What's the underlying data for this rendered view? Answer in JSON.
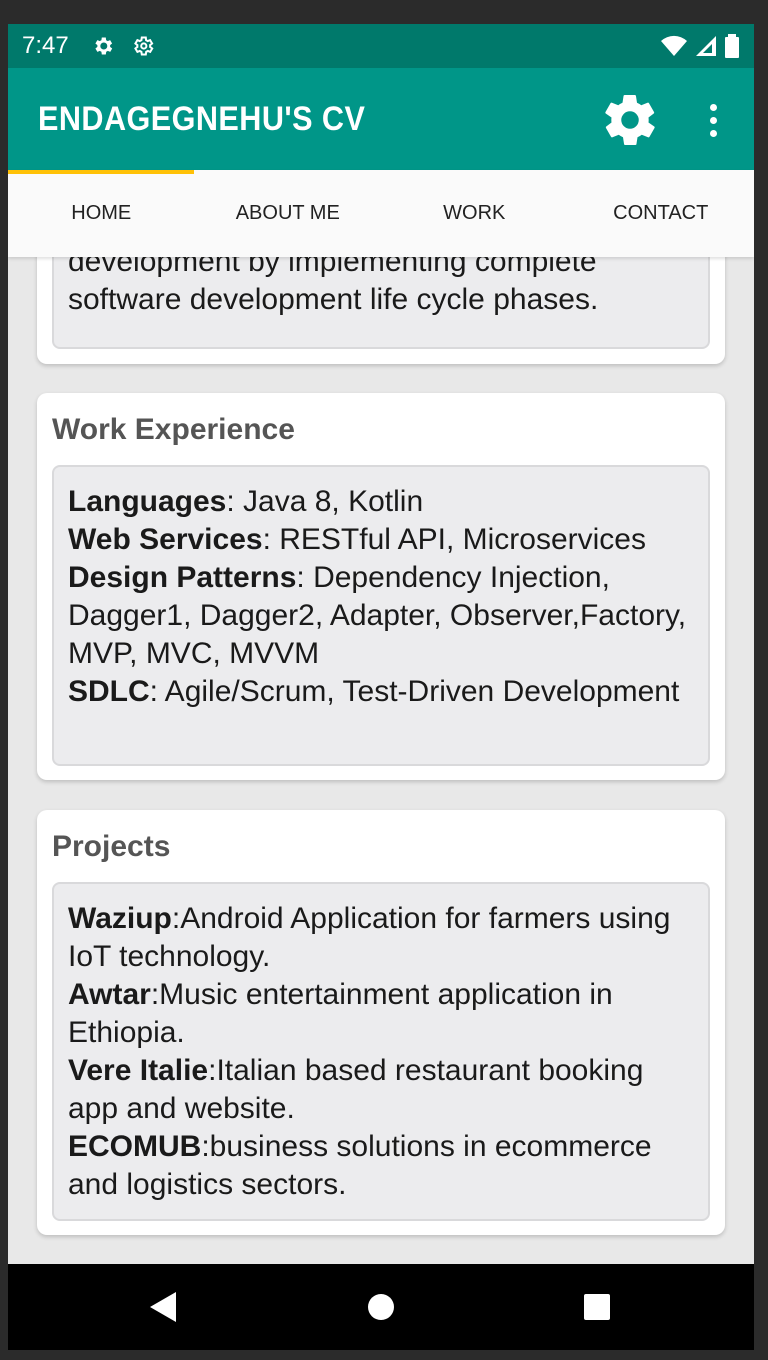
{
  "status_bar": {
    "time": "7:47"
  },
  "app_bar": {
    "title": "ENDAGEGNEHU'S CV"
  },
  "tabs": [
    {
      "label": "HOME"
    },
    {
      "label": "ABOUT ME"
    },
    {
      "label": "WORK"
    },
    {
      "label": "CONTACT"
    }
  ],
  "cards": {
    "summary": {
      "lines": [
        "development by implementing complete",
        "software development life cycle phases."
      ]
    },
    "work": {
      "title": "Work Experience",
      "items": [
        {
          "key": "Languages",
          "value": ": Java 8, Kotlin"
        },
        {
          "key": "Web Services",
          "value": ": RESTful API, Microservices"
        },
        {
          "key": "Design Patterns",
          "value": ": Dependency Injection, Dagger1, Dagger2, Adapter, Observer,Factory, MVP, MVC, MVVM"
        },
        {
          "key": "SDLC",
          "value": ": Agile/Scrum, Test-Driven Development"
        }
      ]
    },
    "projects": {
      "title": "Projects",
      "items": [
        {
          "key": "Waziup",
          "value": ":Android Application for farmers using IoT technology."
        },
        {
          "key": "Awtar",
          "value": ":Music entertainment application in Ethiopia."
        },
        {
          "key": "Vere Italie",
          "value": ":Italian based restaurant booking app and website."
        },
        {
          "key": "ECOMUB",
          "value": ":business solutions in ecommerce and logistics sectors."
        }
      ]
    }
  },
  "colors": {
    "primary": "#009688",
    "primary_dark": "#00796b",
    "accent": "#ffc107"
  }
}
